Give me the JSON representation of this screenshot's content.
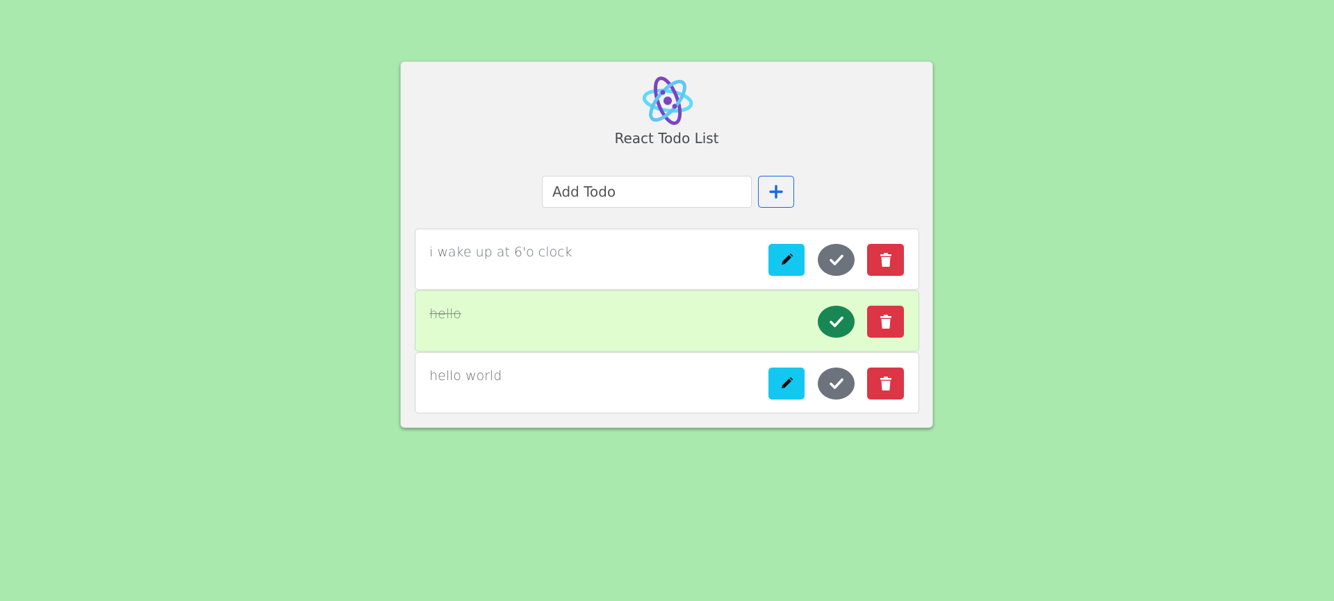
{
  "app": {
    "title": "React Todo List"
  },
  "add_form": {
    "placeholder": "Add Todo",
    "value": ""
  },
  "todos": [
    {
      "text": "i wake up at 6'o clock",
      "completed": false
    },
    {
      "text": "hello",
      "completed": true
    },
    {
      "text": "hello world",
      "completed": false
    }
  ],
  "icons": {
    "logo": "react-atom-logo-icon",
    "add": "plus-icon",
    "edit": "pencil-icon",
    "check": "check-icon",
    "delete": "trash-icon"
  },
  "colors": {
    "background": "#a9e9ae",
    "card": "#f2f2f2",
    "accent_blue": "#1a66e8",
    "edit": "#12c8f0",
    "check_pending": "#6c737d",
    "check_done": "#198754",
    "delete": "#dc3545",
    "done_row": "#e0fdd0"
  }
}
